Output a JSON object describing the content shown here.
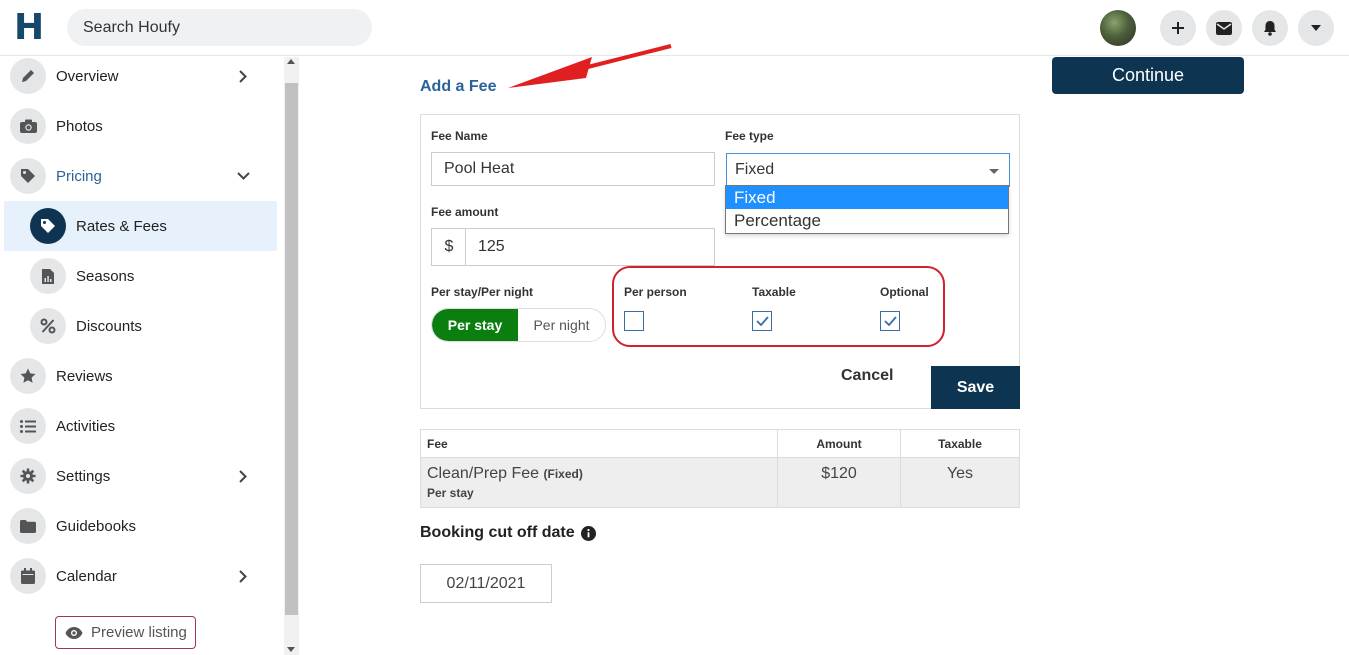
{
  "header": {
    "logo": "H",
    "search_placeholder": "Search Houfy"
  },
  "sidebar": {
    "items": [
      {
        "label": "Overview"
      },
      {
        "label": "Photos"
      },
      {
        "label": "Pricing"
      },
      {
        "label": "Rates & Fees"
      },
      {
        "label": "Seasons"
      },
      {
        "label": "Discounts"
      },
      {
        "label": "Reviews"
      },
      {
        "label": "Activities"
      },
      {
        "label": "Settings"
      },
      {
        "label": "Guidebooks"
      },
      {
        "label": "Calendar"
      }
    ],
    "preview_label": "Preview listing"
  },
  "main": {
    "title": "Add a Fee",
    "continue_label": "Continue",
    "form": {
      "fee_name_label": "Fee Name",
      "fee_name_value": "Pool Heat",
      "fee_type_label": "Fee type",
      "fee_type_value": "Fixed",
      "fee_type_options": [
        "Fixed",
        "Percentage"
      ],
      "fee_amount_label": "Fee amount",
      "currency_symbol": "$",
      "fee_amount_value": "125",
      "per_stay_night_label": "Per stay/Per night",
      "per_stay_label": "Per stay",
      "per_night_label": "Per night",
      "per_person_label": "Per person",
      "taxable_label": "Taxable",
      "optional_label": "Optional",
      "cancel_label": "Cancel",
      "save_label": "Save"
    },
    "table": {
      "headers": [
        "Fee",
        "Amount",
        "Taxable"
      ],
      "row": {
        "fee_name": "Clean/Prep Fee",
        "fee_type": "(Fixed)",
        "fee_period": "Per stay",
        "amount": "$120",
        "taxable": "Yes"
      }
    },
    "cutoff_label": "Booking cut off date",
    "cutoff_date": "02/11/2021"
  },
  "colors": {
    "brand": "#15486b",
    "accent_button": "#0d3552",
    "toggle_green": "#0a7f10",
    "highlight_red": "#d0212d",
    "link_blue": "#2a6299"
  }
}
